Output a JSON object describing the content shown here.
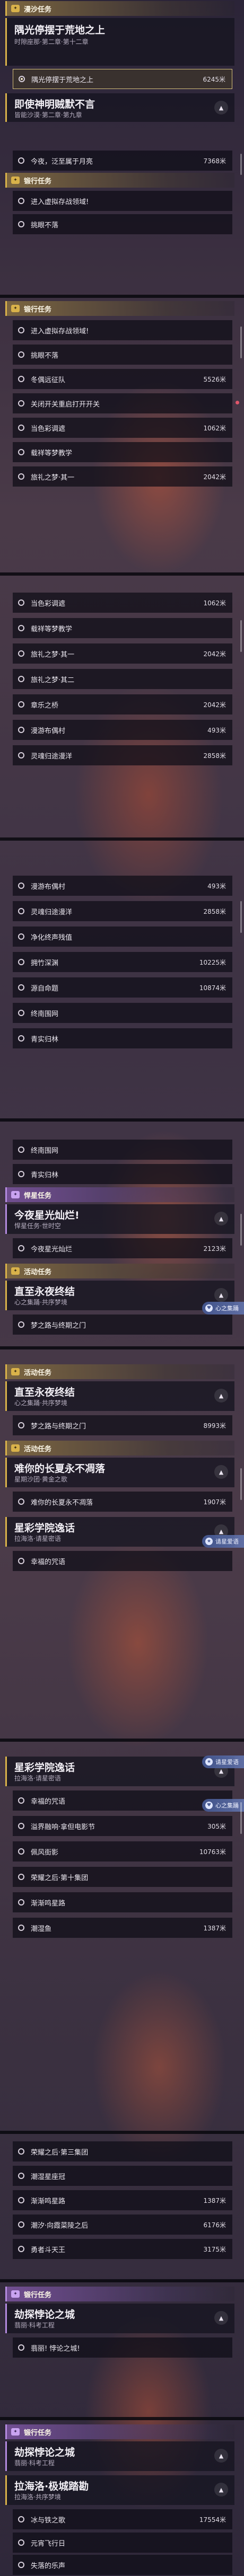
{
  "labels": {
    "header_daily": "漫沙任务",
    "header_forge": "锻行任务",
    "header_trial": "悍星任务",
    "header_event": "活动任务",
    "crew_badge": "心之集踊",
    "partner_badge": "请星爱语"
  },
  "quests": {
    "q1_title": "隅光停摆于荒地之上",
    "q1_sub": "时隙座那·第二章·第十二章",
    "q1_step": "隅光停摆于荒地之上",
    "q1_dist": "6245米",
    "q2_title": "即使神明贼默不言",
    "q2_sub": "皆能沙漠·第二章·第九章",
    "q2_step": "今夜，泛至属于月亮",
    "q2_dist": "7368米",
    "s1": "进入虚拟存战领域!",
    "s2": "挑眼不落",
    "s3": "冬偶远征队",
    "s3_dist": "5526米",
    "s4": "关闭开关重启打开开关",
    "s5": "当色彩调遮",
    "s5_dist": "1062米",
    "s6": "载祥等梦教学",
    "s7": "旅礼之梦·其一",
    "s7_dist": "2042米",
    "s8": "旅礼之梦·其二",
    "s9": "章乐之桥",
    "s9_dist": "2042米",
    "s10": "漫游布偶村",
    "s10_dist": "493米",
    "s11": "灵魂归途漫洋",
    "s11_dist": "2858米",
    "s12": "净化终声残值",
    "s13": "拥竹深渊",
    "s13_dist": "10225米",
    "s14": "源自命题",
    "s14_dist": "10874米",
    "s15": "终南围网",
    "s16": "青实归林",
    "q3_title": "今夜星光灿烂!",
    "q3_sub": "悍星任务·世时空",
    "q3_step": "今夜星光灿烂",
    "q3_dist": "2123米",
    "q4_title": "直至永夜终结",
    "q4_sub": "心之集踊·共序梦境",
    "q4_step": "梦之路与终期之门",
    "q4_dist": "8993米",
    "q5_title": "难你的长夏永不凋落",
    "q5_sub": "星期沙团·黄金之歌",
    "q5_step": "难你的长夏永不凋落",
    "q5_dist": "1907米",
    "q6_title": "星彩学院逸话",
    "q6_sub": "拉海洛·请星密语",
    "q6_step": "幸福的咒语",
    "s17": "溢界融响·拿但电影节",
    "s17_dist": "305米",
    "s18": "佩风街影",
    "s18_dist": "10763米",
    "s19": "荣耀之后·第十集团",
    "s20": "渐渐鸣星路",
    "s21": "荣耀之后·第三集团",
    "s22": "潮湿鱼",
    "s22_dist": "1387米",
    "s23": "潮湿星座冠",
    "s24": "渐渐鸣星路",
    "s24_dist": "1387米",
    "s25": "潮汐·向霞菜陵之后",
    "s25_dist": "6176米",
    "s26": "勇者斗天王",
    "s26_dist": "3175米",
    "q7_title": "劫探悖论之城",
    "q7_sub": "翡丽·科考工程",
    "q7_step": "翡丽! 悖论之城!",
    "q8_title": "拉海洛·极城踏勘",
    "q8_sub": "拉海洛·共序梦境",
    "s27": "冰与铁之歌",
    "s27_dist": "17554米",
    "s28": "元宵飞行日",
    "s29": "失落的乐声"
  },
  "colors": {
    "accent_gold": "#d9b24a",
    "accent_purple": "#b48be0",
    "badge_blue": "#6478b4",
    "alert_red": "#e0566a"
  }
}
